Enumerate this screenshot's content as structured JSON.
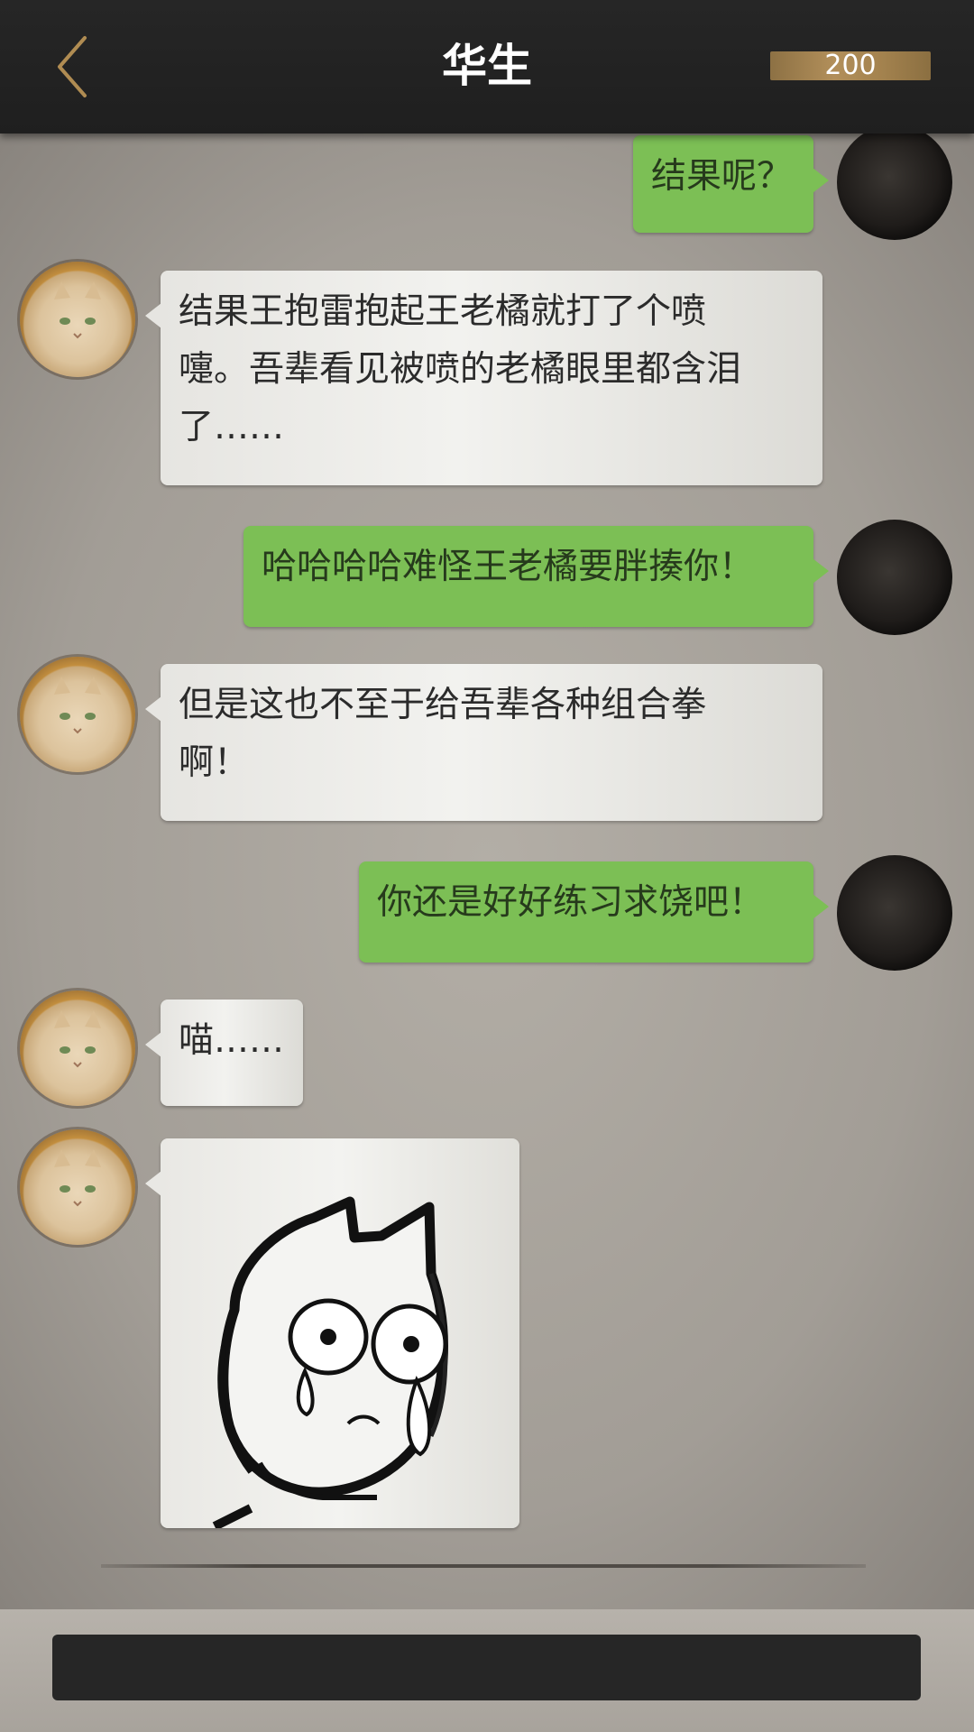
{
  "header": {
    "title": "华生",
    "coins": "200"
  },
  "messages": [
    {
      "from": "me",
      "text": "结果呢？"
    },
    {
      "from": "them",
      "lines": [
        "结果王抱雷抱起王老橘就打了个喷",
        "嚏。吾辈看见被喷的老橘眼里都含泪",
        "了……"
      ]
    },
    {
      "from": "me",
      "text": "哈哈哈哈难怪王老橘要胖揍你！"
    },
    {
      "from": "them",
      "lines": [
        "但是这也不至于给吾辈各种组合拳",
        "啊！"
      ]
    },
    {
      "from": "me",
      "text": "你还是好好练习求饶吧！"
    },
    {
      "from": "them",
      "text": "喵……"
    },
    {
      "from": "them",
      "type": "sticker",
      "sticker": "crying-cat-sticker"
    }
  ],
  "input": {
    "value": ""
  },
  "colors": {
    "my_bubble": "#7cbf55",
    "their_bubble": "#eeeeea",
    "header_bg": "#222222",
    "coin_bar": "#a3824e",
    "back_arrow": "#b08c52"
  },
  "icons": {
    "back": "chevron-left-icon"
  }
}
